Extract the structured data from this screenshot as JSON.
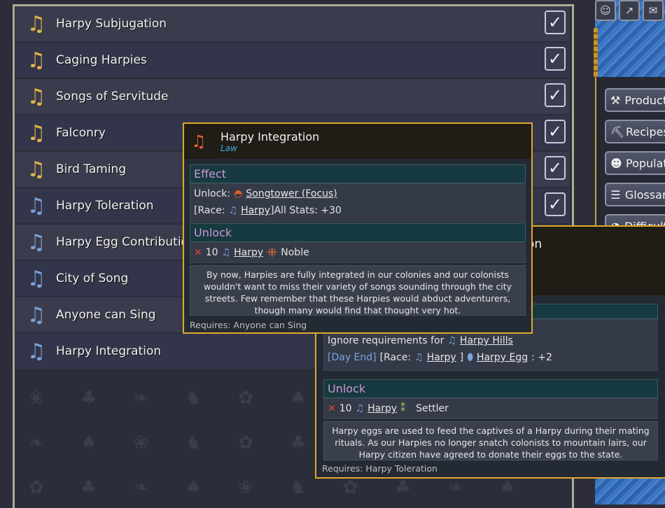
{
  "top_icons": [
    "☺",
    "↗",
    "✉"
  ],
  "side_buttons": [
    {
      "label": "Production",
      "icon": "⚒"
    },
    {
      "label": "Recipes",
      "icon": "⛏"
    },
    {
      "label": "Population",
      "icon": "☻"
    },
    {
      "label": "Glossary",
      "icon": "☰"
    },
    {
      "label": "Difficulty",
      "icon": "◔"
    }
  ],
  "laws": [
    {
      "label": "Harpy Subjugation",
      "color": "gold",
      "checked": true
    },
    {
      "label": "Caging Harpies",
      "color": "gold",
      "checked": true
    },
    {
      "label": "Songs of Servitude",
      "color": "gold",
      "checked": true
    },
    {
      "label": "Falconry",
      "color": "gold",
      "checked": true
    },
    {
      "label": "Bird Taming",
      "color": "gold",
      "checked": true
    },
    {
      "label": "Harpy Toleration",
      "color": "blue",
      "checked": true
    },
    {
      "label": "Harpy Egg Contribution",
      "color": "blue",
      "checked": false
    },
    {
      "label": "City of Song",
      "color": "blue",
      "checked": false
    },
    {
      "label": "Anyone can Sing",
      "color": "blue",
      "checked": false
    },
    {
      "label": "Harpy Integration",
      "color": "blue",
      "checked": false
    }
  ],
  "check_glyph": "✓",
  "music_icon": "♫",
  "tooltip_integration": {
    "title": "Harpy Integration",
    "subtitle": "Law",
    "effect_heading": "Effect",
    "effect_unlock_prefix": "Unlock:",
    "effect_unlock_target": "Songtower (Focus)",
    "race_prefix": "[Race:",
    "race_name": "Harpy",
    "race_suffix": "]All Stats: +30",
    "unlock_heading": "Unlock",
    "unlock_count": "10",
    "unlock_race": "Harpy",
    "unlock_class": "Noble",
    "description": "By now, Harpies are fully integrated in our colonies and our colonists wouldn't want to miss their variety of songs sounding through the city streets. Few remember that these Harpies would abduct adventurers, though many would find that thought very hot.",
    "requires": "Requires: Anyone can Sing"
  },
  "tooltip_egg": {
    "title_fragment": "on",
    "ignore_label": "Ignore requirements for",
    "ignore_target": "Harpy Hills",
    "dayend": "[Day End]",
    "race_prefix": "[Race:",
    "race_name": "Harpy",
    "race_suffix": "]",
    "egg_item": "Harpy Egg",
    "egg_amount": ": +2",
    "unlock_heading": "Unlock",
    "unlock_count": "10",
    "unlock_race": "Harpy",
    "unlock_class": "Settler",
    "description": "Harpy eggs are used to feed the captives of a Harpy during their mating rituals. As our Harpies no longer snatch colonists to mountain lairs, our Harpy citizen have agreed to donate their eggs to the state.",
    "requires": "Requires: Harpy Toleration"
  },
  "colors": {
    "accent_border": "#e0a82e",
    "section_heading": "#d692d8",
    "gold_icon": "#e2b54a",
    "blue_icon": "#7aa3d8"
  }
}
